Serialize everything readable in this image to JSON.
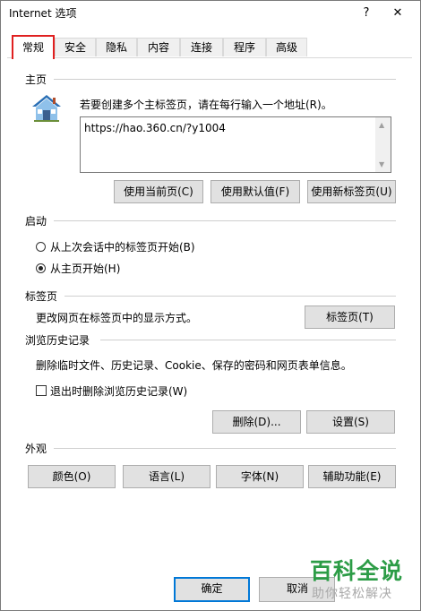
{
  "window": {
    "title": "Internet 选项",
    "help_glyph": "?",
    "close_glyph": "✕"
  },
  "tabs": [
    "常规",
    "安全",
    "隐私",
    "内容",
    "连接",
    "程序",
    "高级"
  ],
  "homepage": {
    "section": "主页",
    "instruction": "若要创建多个主标签页，请在每行输入一个地址(R)。",
    "url": "https://hao.360.cn/?y1004",
    "btn_current": "使用当前页(C)",
    "btn_default": "使用默认值(F)",
    "btn_newtab": "使用新标签页(U)"
  },
  "startup": {
    "section": "启动",
    "opt_last_session": "从上次会话中的标签页开始(B)",
    "opt_home": "从主页开始(H)",
    "selected": "opt_home"
  },
  "tabs_section": {
    "section": "标签页",
    "desc": "更改网页在标签页中的显示方式。",
    "btn": "标签页(T)"
  },
  "history": {
    "section": "浏览历史记录",
    "desc": "删除临时文件、历史记录、Cookie、保存的密码和网页表单信息。",
    "checkbox": "退出时删除浏览历史记录(W)",
    "checked": false,
    "btn_delete": "删除(D)...",
    "btn_settings": "设置(S)"
  },
  "appearance": {
    "section": "外观",
    "btn_colors": "颜色(O)",
    "btn_languages": "语言(L)",
    "btn_fonts": "字体(N)",
    "btn_accessibility": "辅助功能(E)"
  },
  "footer": {
    "ok": "确定",
    "cancel": "取消"
  },
  "watermark": {
    "big": "百科全说",
    "small": "助你轻松解决"
  },
  "colors": {
    "highlight": "#e02020",
    "default_button_border": "#0078d7",
    "watermark_green": "#2c9c46"
  }
}
